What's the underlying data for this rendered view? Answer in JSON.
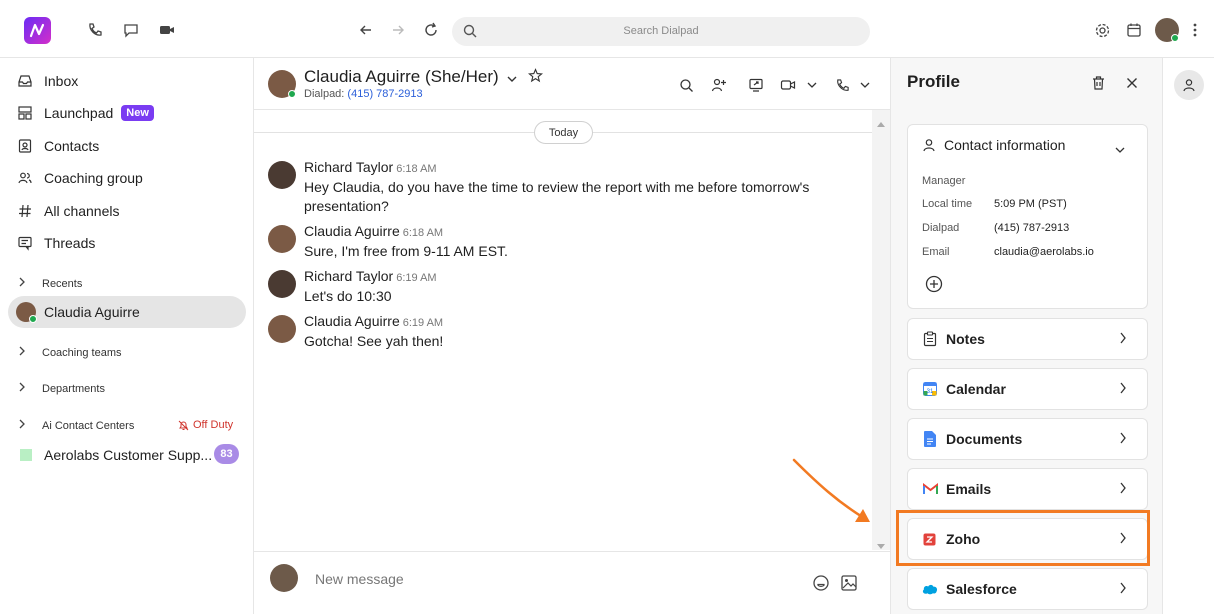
{
  "topbar": {
    "logo_icon": "dialpad-logo-icon",
    "search_placeholder": "Search Dialpad"
  },
  "sidebar": {
    "items": [
      {
        "label": "Inbox",
        "icon": "inbox-icon"
      },
      {
        "label": "Launchpad",
        "icon": "launchpad-icon",
        "badge": "New"
      },
      {
        "label": "Contacts",
        "icon": "contacts-icon"
      },
      {
        "label": "Coaching group",
        "icon": "group-icon"
      },
      {
        "label": "All channels",
        "icon": "hash-icon"
      },
      {
        "label": "Threads",
        "icon": "threads-icon"
      }
    ],
    "recents_label": "Recents",
    "active_contact": "Claudia Aguirre",
    "coaching_teams_label": "Coaching teams",
    "departments_label": "Departments",
    "ai_centers_label": "Ai Contact Centers",
    "off_duty_label": "Off Duty",
    "aerolabs_label": "Aerolabs Customer Supp...",
    "aerolabs_count": "83"
  },
  "chat": {
    "contact_name": "Claudia Aguirre (She/Her)",
    "dialpad_label": "Dialpad:",
    "dialpad_number": "(415) 787-2913",
    "today_label": "Today",
    "messages": [
      {
        "sender": "Richard Taylor",
        "time": "6:18 AM",
        "text": "Hey Claudia, do you have the time to review the report with me before tomorrow's presentation?"
      },
      {
        "sender": "Claudia Aguirre",
        "time": "6:18 AM",
        "text": "Sure, I'm free from 9-11 AM EST."
      },
      {
        "sender": "Richard Taylor",
        "time": "6:19 AM",
        "text": "Let's do 10:30"
      },
      {
        "sender": "Claudia Aguirre",
        "time": "6:19 AM",
        "text": "Gotcha! See yah then!"
      }
    ],
    "composer_placeholder": "New message"
  },
  "profile": {
    "title": "Profile",
    "contact_info_label": "Contact information",
    "role": "Manager",
    "local_time_label": "Local time",
    "local_time": "5:09 PM (PST)",
    "dialpad_label": "Dialpad",
    "dialpad_number": "(415) 787-2913",
    "email_label": "Email",
    "email": "claudia@aerolabs.io",
    "sections": [
      {
        "label": "Notes",
        "icon": "notes-icon"
      },
      {
        "label": "Calendar",
        "icon": "calendar-icon"
      },
      {
        "label": "Documents",
        "icon": "documents-icon"
      },
      {
        "label": "Emails",
        "icon": "gmail-icon"
      },
      {
        "label": "Zoho",
        "icon": "zoho-icon"
      },
      {
        "label": "Salesforce",
        "icon": "salesforce-icon"
      }
    ]
  },
  "colors": {
    "accent": "#7a3cf2",
    "highlight": "#f27a22",
    "link": "#2b5fd9",
    "off_duty": "#d0342c"
  }
}
